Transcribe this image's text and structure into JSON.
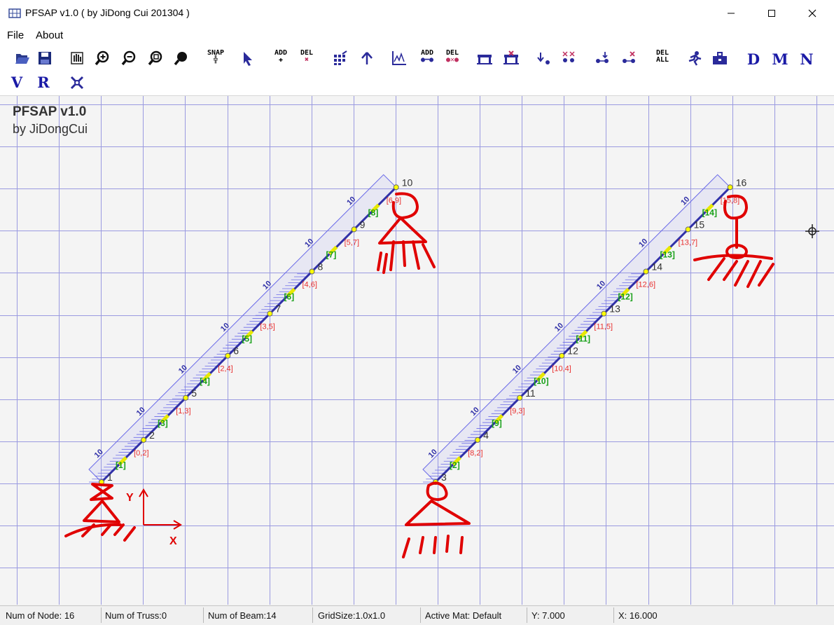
{
  "window": {
    "title": "PFSAP v1.0 ( by JiDong Cui 201304 )",
    "minimize_glyph": "—",
    "maximize_glyph": "☐",
    "close_glyph": "✕"
  },
  "menu": [
    "File",
    "About"
  ],
  "toolbar": {
    "snap": "SNAP",
    "add": "ADD",
    "del": "DEL",
    "del_all_1": "DEL",
    "del_all_2": "ALL",
    "letters": [
      "D",
      "M",
      "N",
      "V",
      "R"
    ]
  },
  "logo": {
    "title": "PFSAP v1.0",
    "subtitle": "by JiDongCui"
  },
  "axes": {
    "y": "Y",
    "x": "X"
  },
  "model": {
    "load_value": "10",
    "node_labels_left": [
      "1",
      "2",
      "5",
      "6",
      "7",
      "8",
      "9",
      "10"
    ],
    "node_labels_right": [
      "3",
      "4",
      "11",
      "12",
      "13",
      "14",
      "15",
      "16"
    ],
    "element_labels_left": [
      "[1]",
      "[3]",
      "[4]",
      "[5]",
      "[6]",
      "[7]",
      "[8]"
    ],
    "element_labels_right": [
      "[2]",
      "[9]",
      "[10]",
      "[11]",
      "[12]",
      "[13]",
      "[14]"
    ],
    "section_labels_left": [
      "[0,2]",
      "[1,3]",
      "[2,4]",
      "[3,5]",
      "[4,6]",
      "[5,7]",
      "[6,9]"
    ],
    "section_labels_right": [
      "[8,2]",
      "[9,3]",
      "[10,4]",
      "[11,5]",
      "[12,6]",
      "[13,7]",
      "[15,8]"
    ]
  },
  "status": {
    "nodes": "Num of Node: 16",
    "truss": "Num of Truss:0",
    "beam": "Num of Beam:14",
    "grid": "GridSize:1.0x1.0",
    "mat": "Active Mat: Default",
    "y": "Y: 7.000",
    "x": "X: 16.000"
  },
  "colors": {
    "grid": "#9a9ae0",
    "beam": "#3030a8",
    "load": "#6b6be8",
    "node": "#ffff00",
    "element_label": "#18a018",
    "section_label": "#e83030",
    "annotation": "#e00000"
  }
}
